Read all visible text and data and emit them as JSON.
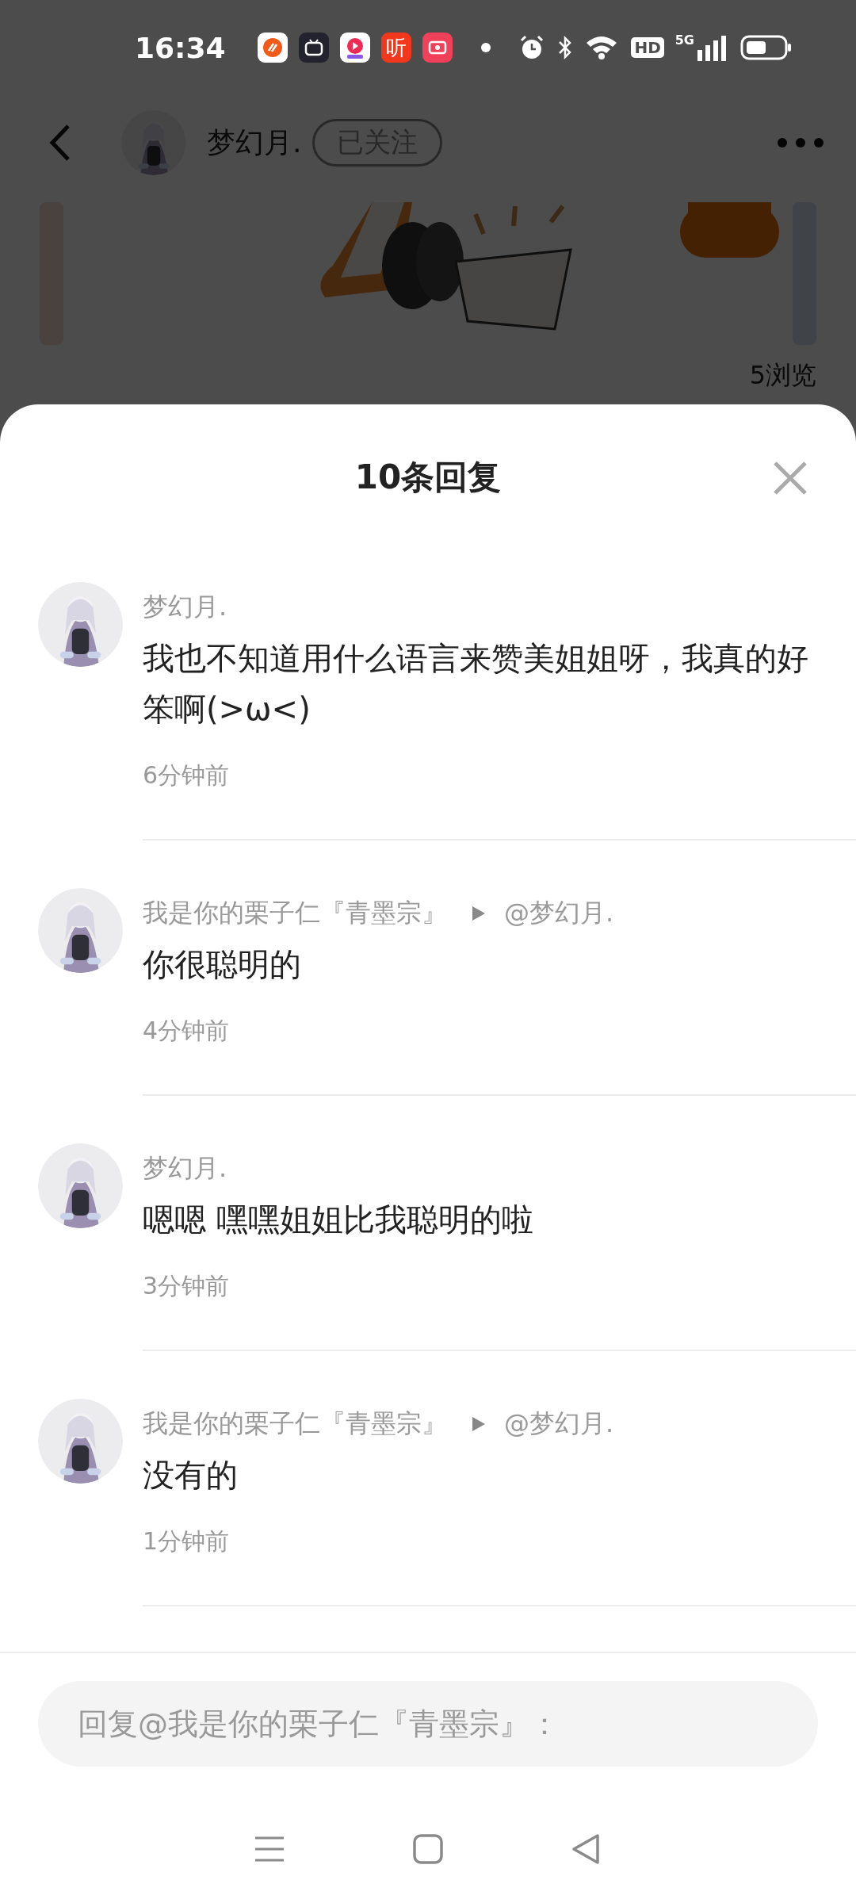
{
  "status_bar": {
    "time": "16:34",
    "app_label": "听",
    "hd_badge": "HD",
    "network": "5G"
  },
  "header": {
    "user_name": "梦幻月.",
    "follow_button": "已关注"
  },
  "post": {
    "views": "5浏览"
  },
  "sheet": {
    "title": "10条回复",
    "comments": [
      {
        "name": "梦幻月.",
        "content": "我也不知道用什么语言来赞美姐姐呀，我真的好笨啊(>ω<)",
        "time": "6分钟前"
      },
      {
        "name": "我是你的栗子仁『青墨宗』",
        "reply_to": "@梦幻月.",
        "content": "你很聪明的",
        "time": "4分钟前"
      },
      {
        "name": "梦幻月.",
        "content": "嗯嗯 嘿嘿姐姐比我聪明的啦",
        "time": "3分钟前"
      },
      {
        "name": "我是你的栗子仁『青墨宗』",
        "reply_to": "@梦幻月.",
        "content": "没有的",
        "time": "1分钟前"
      }
    ],
    "reply_field": {
      "placeholder": "回复@我是你的栗子仁『青墨宗』："
    }
  }
}
